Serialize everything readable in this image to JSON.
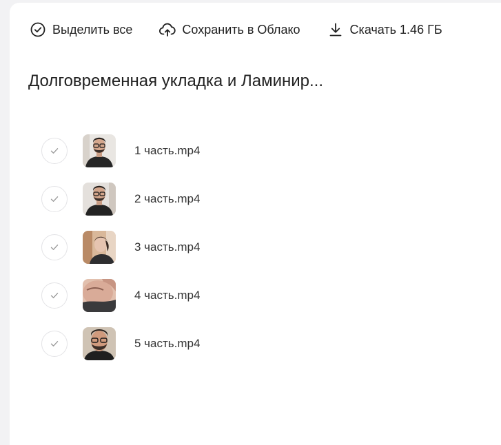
{
  "toolbar": {
    "select_all_label": "Выделить все",
    "save_cloud_label": "Сохранить в Облако",
    "download_label": "Скачать 1.46 ГБ"
  },
  "folder": {
    "title": "Долговременная укладка и Ламинир..."
  },
  "files": [
    {
      "name": "1 часть.mp4",
      "thumb": "man-glasses"
    },
    {
      "name": "2 часть.mp4",
      "thumb": "man-glasses"
    },
    {
      "name": "3 часть.mp4",
      "thumb": "woman-profile"
    },
    {
      "name": "4 часть.mp4",
      "thumb": "face-closeup"
    },
    {
      "name": "5 часть.mp4",
      "thumb": "man-glasses-closeup"
    }
  ],
  "colors": {
    "text": "#1f1f1f",
    "check_border": "#e3e3e6",
    "check_mark": "#9a9a9a",
    "background": "#f2f2f4"
  }
}
